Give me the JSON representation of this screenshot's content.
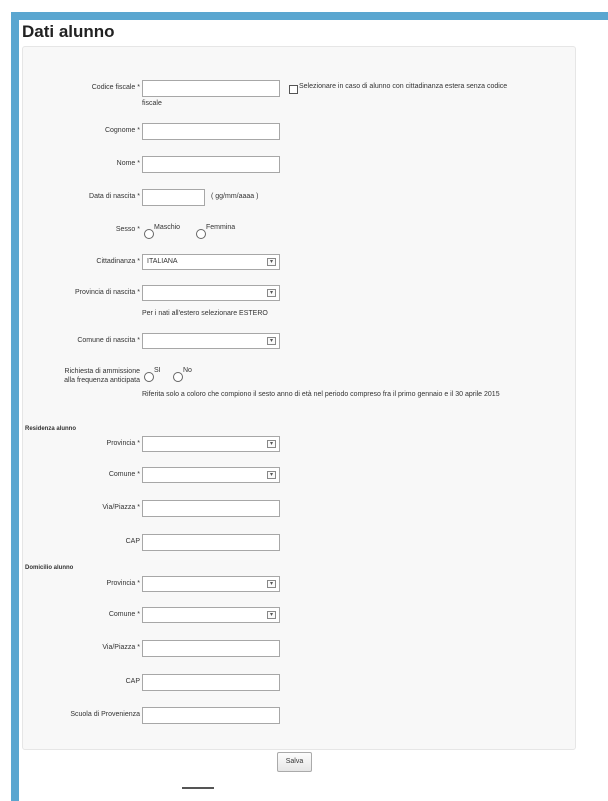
{
  "title": "Dati alunno",
  "fields": {
    "codice_fiscale": {
      "label": "Codice fiscale *",
      "value": ""
    },
    "estero_checkbox": {
      "label": "Selezionare in caso di alunno con cittadinanza estera senza codice",
      "label_cont": "fiscale",
      "checked": false
    },
    "cognome": {
      "label": "Cognome *",
      "value": ""
    },
    "nome": {
      "label": "Nome *",
      "value": ""
    },
    "data_nascita": {
      "label": "Data di nascita *",
      "value": "",
      "hint": "( gg/mm/aaaa )"
    },
    "sesso": {
      "label": "Sesso *",
      "options": [
        "Maschio",
        "Femmina"
      ]
    },
    "cittadinanza": {
      "label": "Cittadinanza *",
      "value": "ITALIANA"
    },
    "provincia_nascita": {
      "label": "Provincia di nascita *",
      "value": "",
      "note": "Per i nati all'estero selezionare ESTERO"
    },
    "comune_nascita": {
      "label": "Comune di nascita *",
      "value": ""
    },
    "anticipata": {
      "label": "Richiesta di ammissione alla frequenza anticipata",
      "options": [
        "SI",
        "No"
      ],
      "note": "Riferita solo a coloro che compiono il sesto anno di età nel periodo compreso fra il primo gennaio e il 30 aprile 2015"
    }
  },
  "residenza": {
    "heading": "Residenza alunno",
    "provincia": {
      "label": "Provincia *",
      "value": ""
    },
    "comune": {
      "label": "Comune *",
      "value": ""
    },
    "via": {
      "label": "Via/Piazza *",
      "value": ""
    },
    "cap": {
      "label": "CAP",
      "value": ""
    }
  },
  "domicilio": {
    "heading": "Domicilio alunno",
    "provincia": {
      "label": "Provincia *",
      "value": ""
    },
    "comune": {
      "label": "Comune *",
      "value": ""
    },
    "via": {
      "label": "Via/Piazza *",
      "value": ""
    },
    "cap": {
      "label": "CAP",
      "value": ""
    }
  },
  "scuola_provenienza": {
    "label": "Scuola di Provenienza",
    "value": ""
  },
  "save_label": "Salva"
}
